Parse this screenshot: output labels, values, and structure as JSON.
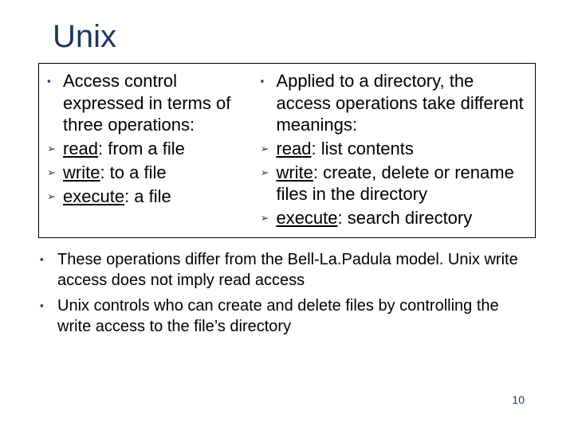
{
  "title": "Unix",
  "left": {
    "head": "Access control expressed in terms of three operations:",
    "items": [
      {
        "u": "read",
        "rest": ": from a file"
      },
      {
        "u": "write",
        "rest": ": to a file"
      },
      {
        "u": "execute",
        "rest": ": a file"
      }
    ]
  },
  "right": {
    "head": "Applied to a directory, the access operations take different meanings:",
    "items": [
      {
        "u": "read",
        "rest": ": list contents"
      },
      {
        "u": "write",
        "rest": ": create, delete or rename files in the directory"
      },
      {
        "u": "execute",
        "rest": ": search directory"
      }
    ]
  },
  "lower": [
    "These operations differ from the Bell-La.Padula model. Unix write access does not imply read access",
    "Unix controls who can create and delete files by controlling the write access to the file’s directory"
  ],
  "page": "10"
}
